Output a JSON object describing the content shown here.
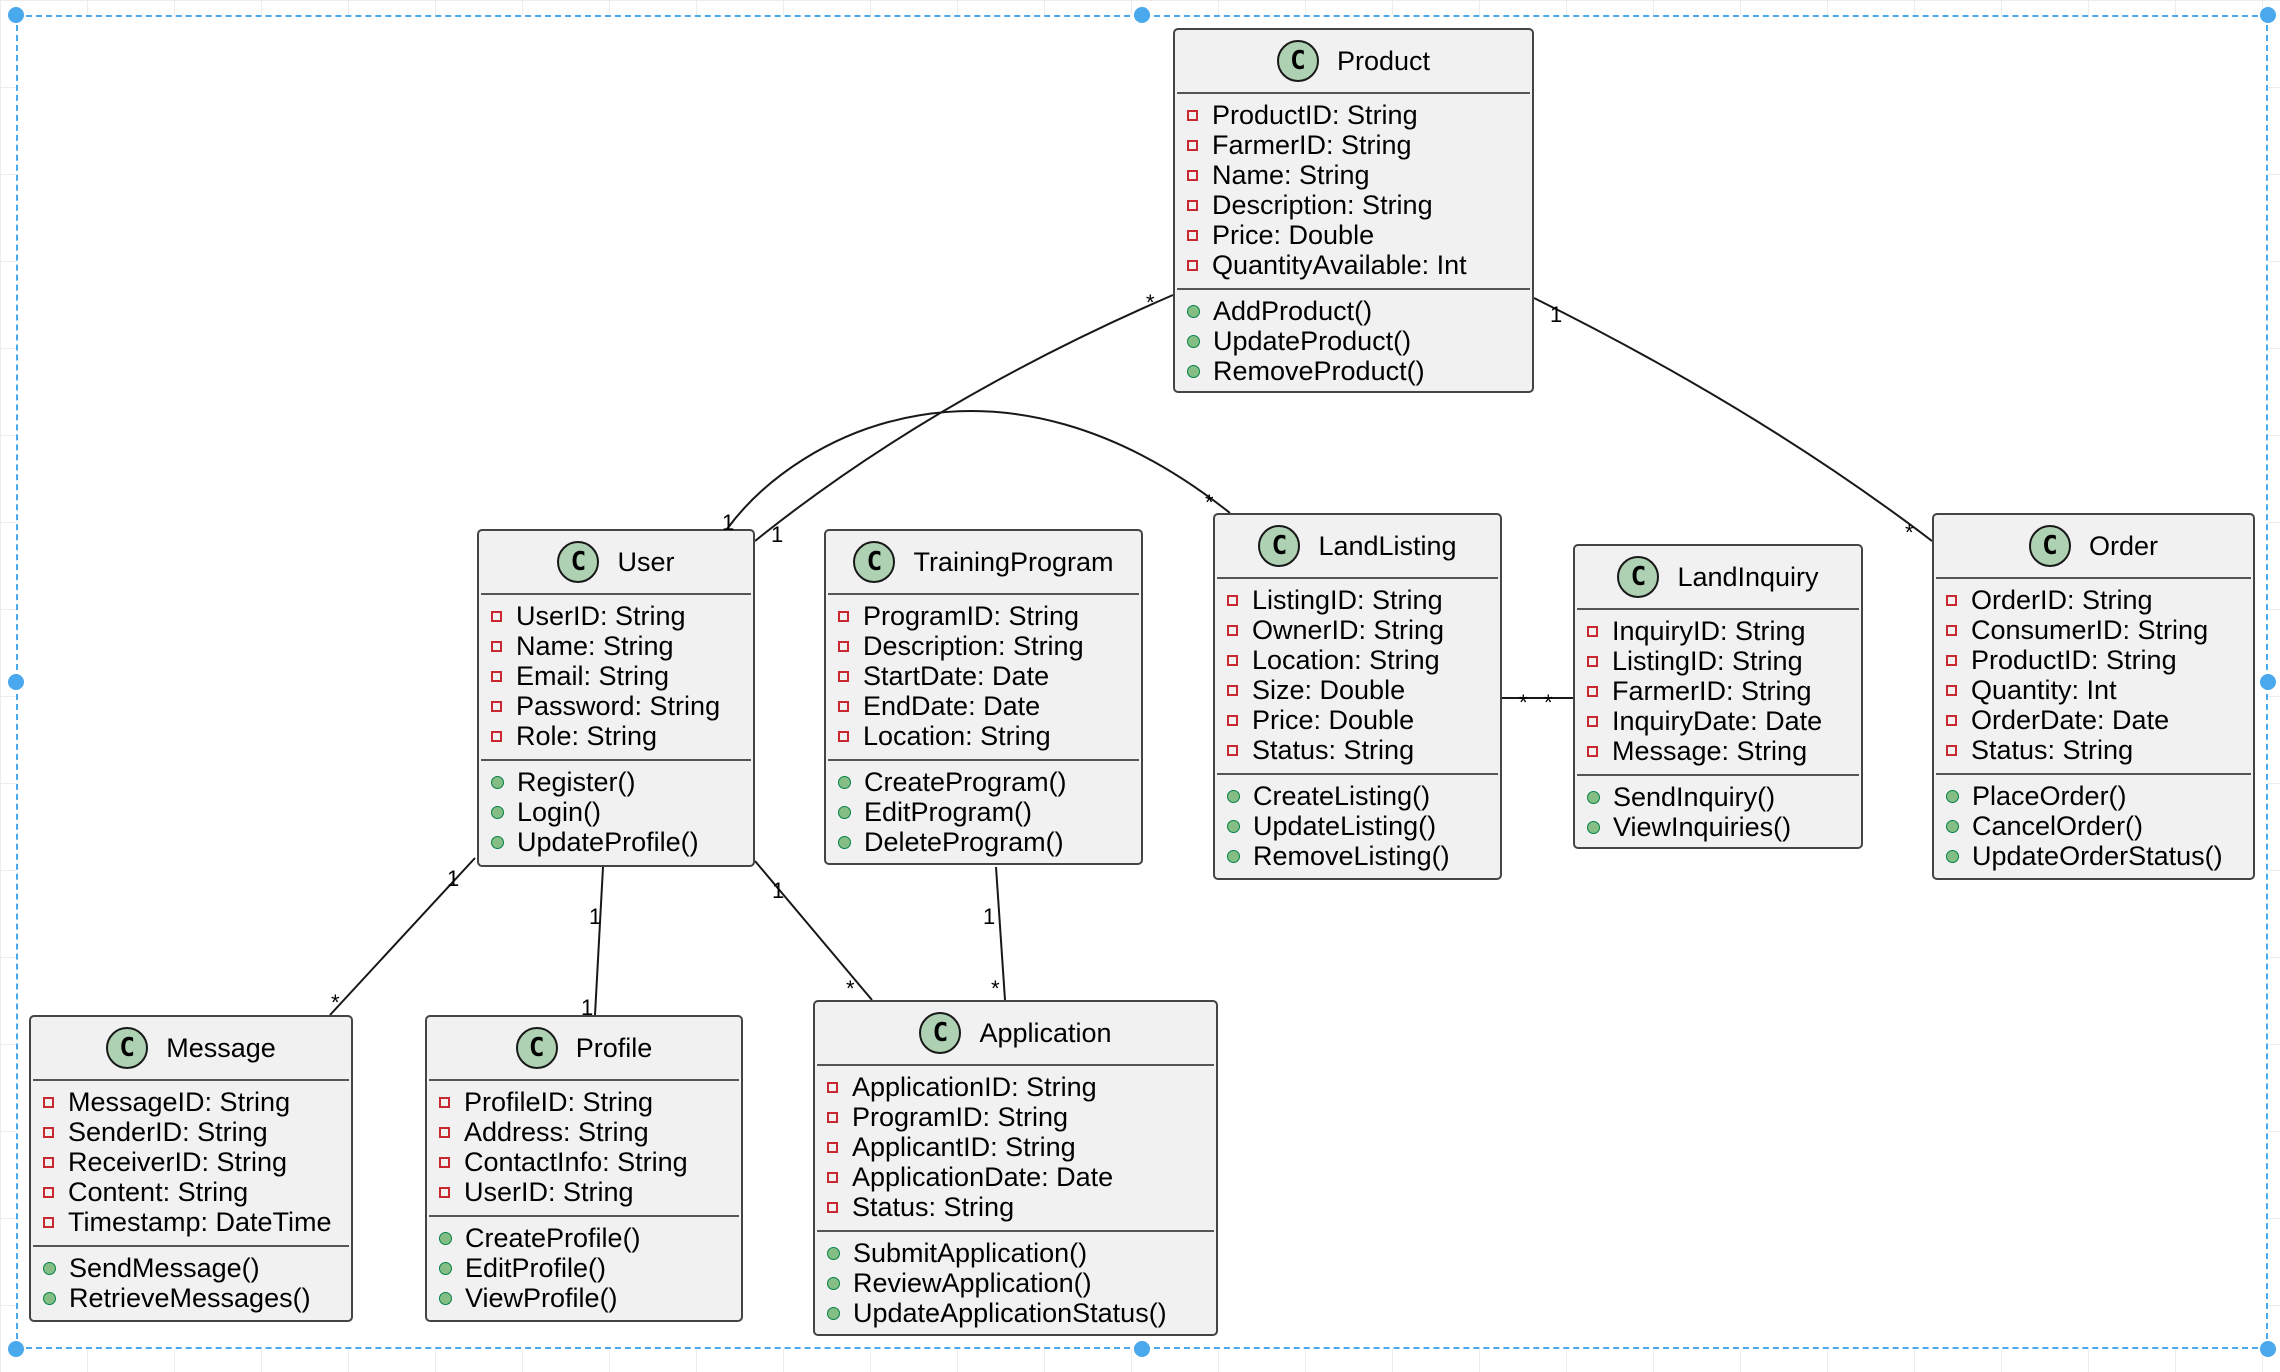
{
  "diagram": {
    "class_icon_letter": "C",
    "colors": {
      "class_fill": "#f1f1f1",
      "class_icon": "#add1b2",
      "private_marker": "#c82930",
      "public_marker": "#84be84",
      "selection": "#4aa8ec"
    },
    "classes": [
      {
        "name": "Product",
        "attributes": [
          "ProductID: String",
          "FarmerID: String",
          "Name: String",
          "Description: String",
          "Price: Double",
          "QuantityAvailable: Int"
        ],
        "methods": [
          "AddProduct()",
          "UpdateProduct()",
          "RemoveProduct()"
        ]
      },
      {
        "name": "User",
        "attributes": [
          "UserID: String",
          "Name: String",
          "Email: String",
          "Password: String",
          "Role: String"
        ],
        "methods": [
          "Register()",
          "Login()",
          "UpdateProfile()"
        ]
      },
      {
        "name": "TrainingProgram",
        "attributes": [
          "ProgramID: String",
          "Description: String",
          "StartDate: Date",
          "EndDate: Date",
          "Location: String"
        ],
        "methods": [
          "CreateProgram()",
          "EditProgram()",
          "DeleteProgram()"
        ]
      },
      {
        "name": "LandListing",
        "attributes": [
          "ListingID: String",
          "OwnerID: String",
          "Location: String",
          "Size: Double",
          "Price: Double",
          "Status: String"
        ],
        "methods": [
          "CreateListing()",
          "UpdateListing()",
          "RemoveListing()"
        ]
      },
      {
        "name": "LandInquiry",
        "attributes": [
          "InquiryID: String",
          "ListingID: String",
          "FarmerID: String",
          "InquiryDate: Date",
          "Message: String"
        ],
        "methods": [
          "SendInquiry()",
          "ViewInquiries()"
        ]
      },
      {
        "name": "Order",
        "attributes": [
          "OrderID: String",
          "ConsumerID: String",
          "ProductID: String",
          "Quantity: Int",
          "OrderDate: Date",
          "Status: String"
        ],
        "methods": [
          "PlaceOrder()",
          "CancelOrder()",
          "UpdateOrderStatus()"
        ]
      },
      {
        "name": "Message",
        "attributes": [
          "MessageID: String",
          "SenderID: String",
          "ReceiverID: String",
          "Content: String",
          "Timestamp: DateTime"
        ],
        "methods": [
          "SendMessage()",
          "RetrieveMessages()"
        ]
      },
      {
        "name": "Profile",
        "attributes": [
          "ProfileID: String",
          "Address: String",
          "ContactInfo: String",
          "UserID: String"
        ],
        "methods": [
          "CreateProfile()",
          "EditProfile()",
          "ViewProfile()"
        ]
      },
      {
        "name": "Application",
        "attributes": [
          "ApplicationID: String",
          "ProgramID: String",
          "ApplicantID: String",
          "ApplicationDate: Date",
          "Status: String"
        ],
        "methods": [
          "SubmitApplication()",
          "ReviewApplication()",
          "UpdateApplicationStatus()"
        ]
      }
    ],
    "associations": [
      {
        "from": "Product",
        "to": "User",
        "from_mult": "*",
        "to_mult": "1"
      },
      {
        "from": "User",
        "to": "LandListing",
        "from_mult": "1",
        "to_mult": "*"
      },
      {
        "from": "Product",
        "to": "Order",
        "from_mult": "1",
        "to_mult": "*"
      },
      {
        "from": "LandListing",
        "to": "LandInquiry",
        "from_mult": "*",
        "to_mult": "*"
      },
      {
        "from": "User",
        "to": "Message",
        "from_mult": "1",
        "to_mult": "*"
      },
      {
        "from": "User",
        "to": "Profile",
        "from_mult": "1",
        "to_mult": "1"
      },
      {
        "from": "User",
        "to": "Application",
        "from_mult": "1",
        "to_mult": "*"
      },
      {
        "from": "TrainingProgram",
        "to": "Application",
        "from_mult": "1",
        "to_mult": "*"
      }
    ]
  }
}
